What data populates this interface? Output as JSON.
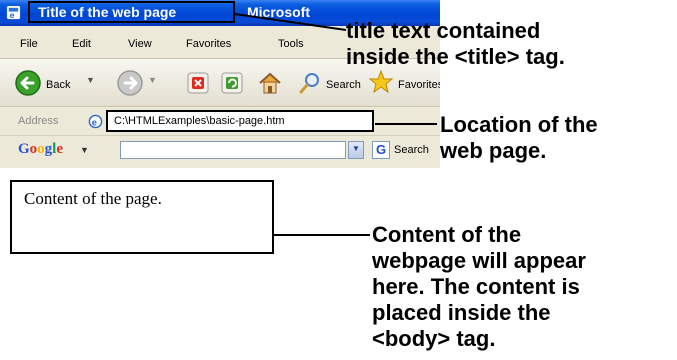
{
  "browser": {
    "title": "Title of the web page",
    "app_name": "Microsoft",
    "menu": [
      "File",
      "Edit",
      "View",
      "Favorites",
      "Tools"
    ],
    "toolbar": {
      "back_label": "Back",
      "search_label": "Search",
      "favorites_label": "Favorites"
    },
    "address": {
      "label": "Address",
      "value": "C:\\HTMLExamples\\basic-page.htm"
    },
    "google": {
      "logo": "Google",
      "search_label": "Search"
    }
  },
  "page": {
    "content_text": "Content of the page."
  },
  "annotations": {
    "title_note": [
      "title text contained",
      "inside the <title> tag."
    ],
    "location_note": [
      "Location of the",
      "web page."
    ],
    "content_note": [
      "Content of the",
      "webpage will appear",
      "here. The content is",
      "placed inside the",
      "<body> tag."
    ]
  },
  "colors": {
    "titlebar_blue": "#0046d5",
    "toolbar_bg": "#ece9d8"
  }
}
